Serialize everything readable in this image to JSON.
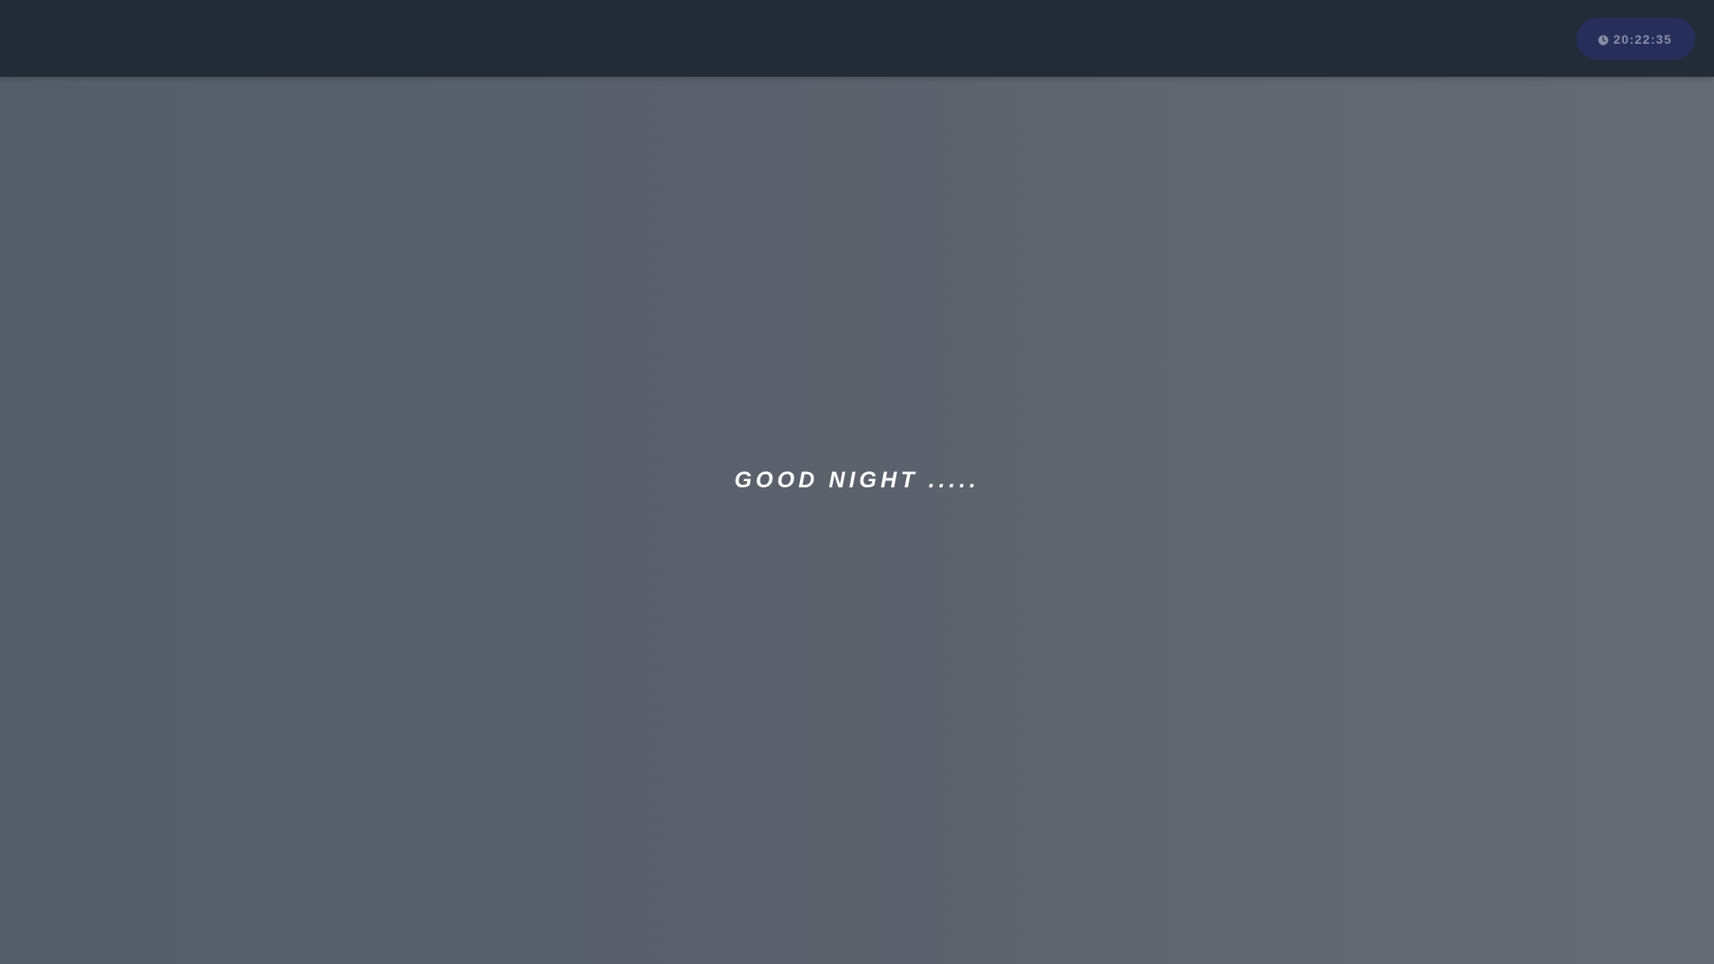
{
  "header": {
    "clock": {
      "icon": "clock-icon",
      "time": "20:22:35"
    }
  },
  "main": {
    "greeting": "GOOD NIGHT ....."
  },
  "colors": {
    "header_bg": "#242b38",
    "clock_pill_bg": "#252f5a",
    "clock_text": "#8a8fa6",
    "greeting_text": "#ffffff"
  }
}
